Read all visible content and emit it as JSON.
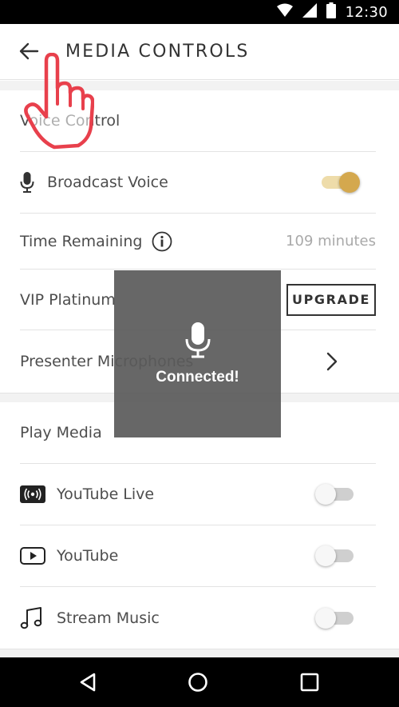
{
  "status_bar": {
    "time": "12:30",
    "icons": [
      "wifi-icon",
      "signal-icon",
      "battery-icon"
    ]
  },
  "header": {
    "title": "MEDIA CONTROLS",
    "back_icon": "arrow-left-icon"
  },
  "voice_section": {
    "heading": "Voice Control",
    "broadcast": {
      "label": "Broadcast Voice",
      "icon": "microphone-icon",
      "enabled": true
    },
    "time_remaining": {
      "label": "Time Remaining",
      "info_icon": "info-icon",
      "value": "109 minutes"
    },
    "vip": {
      "label": "VIP Platinum",
      "button_label": "UPGRADE"
    },
    "presenter": {
      "label": "Presenter Microphones",
      "icon": "chevron-right-icon"
    }
  },
  "media_section": {
    "heading": "Play Media",
    "items": [
      {
        "label": "YouTube Live",
        "icon": "broadcast-live-icon",
        "enabled": false
      },
      {
        "label": "YouTube",
        "icon": "play-box-icon",
        "enabled": false
      },
      {
        "label": "Stream Music",
        "icon": "music-note-icon",
        "enabled": false
      }
    ]
  },
  "toast": {
    "icon": "microphone-icon",
    "message": "Connected!"
  },
  "nav_bar": {
    "buttons": [
      "back-triangle-icon",
      "home-circle-icon",
      "recents-square-icon"
    ]
  },
  "colors": {
    "accent": "#d4a84e",
    "accent_track": "#eedcaa",
    "hand_overlay": "#e8404c"
  }
}
